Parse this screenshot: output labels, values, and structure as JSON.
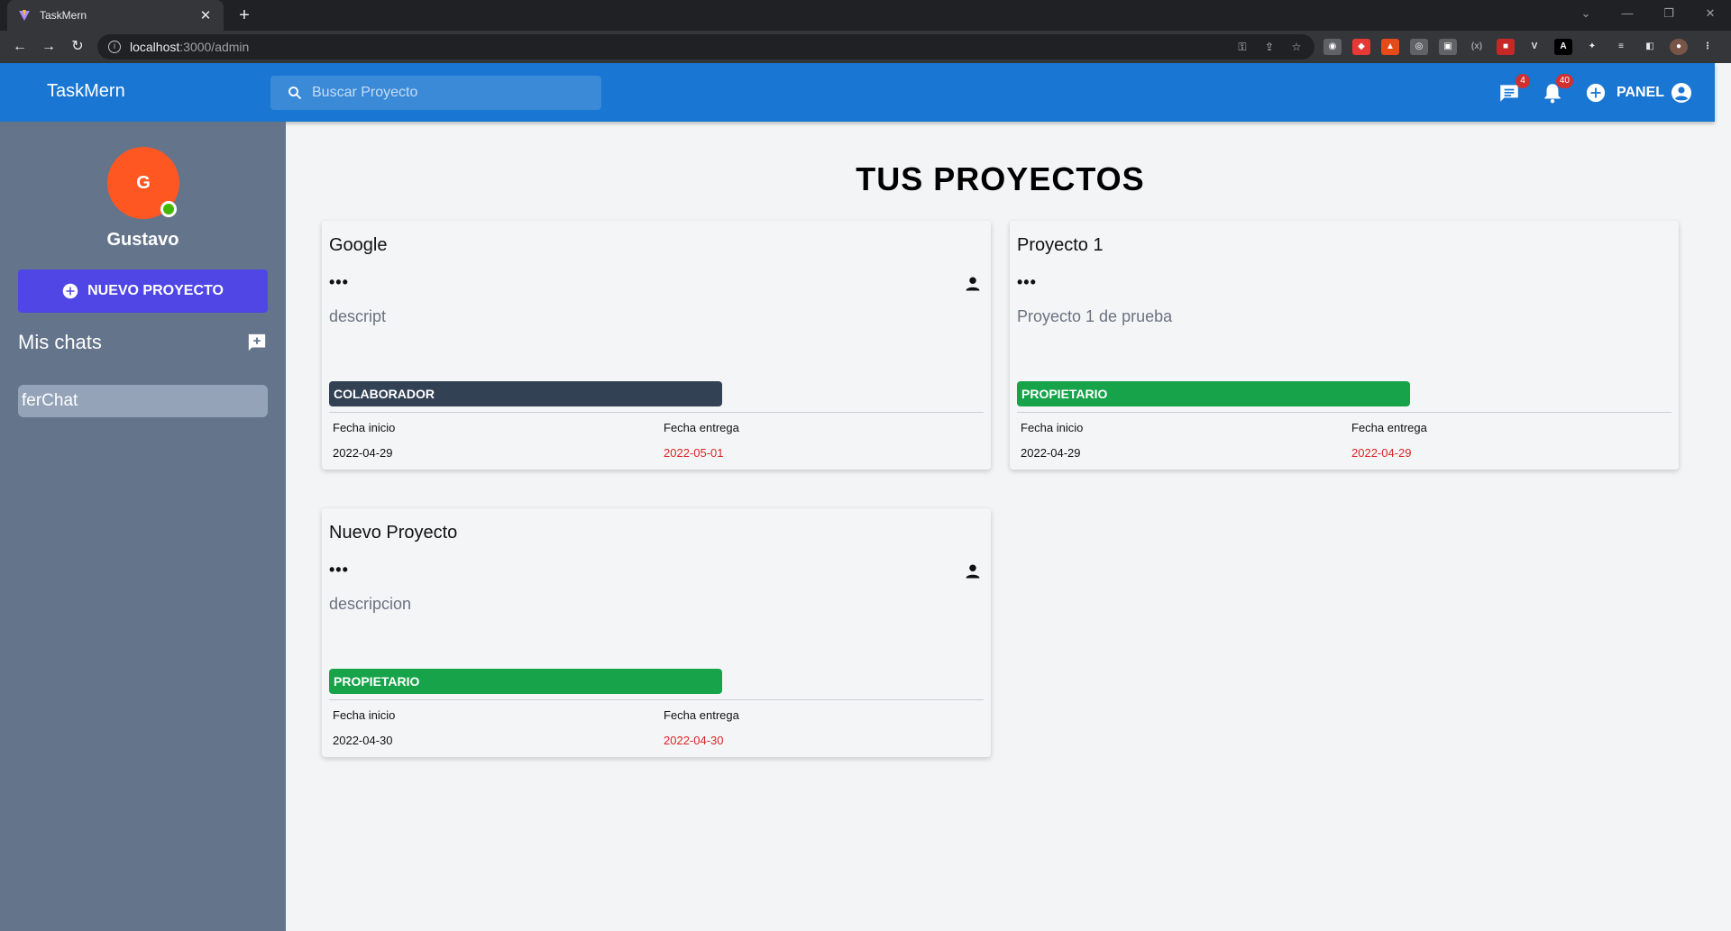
{
  "browser": {
    "tab_title": "TaskMern",
    "url_host": "localhost",
    "url_path": ":3000/admin"
  },
  "app": {
    "brand": "TaskMern",
    "search_placeholder": "Buscar Proyecto",
    "chat_badge": "4",
    "notif_badge": "40",
    "panel_label": "PANEL"
  },
  "sidebar": {
    "avatar_initial": "G",
    "username": "Gustavo",
    "new_project_label": "NUEVO PROYECTO",
    "chats_title": "Mis chats",
    "chats": [
      "ferChat"
    ]
  },
  "main": {
    "title": "TUS PROYECTOS",
    "label_start": "Fecha inicio",
    "label_due": "Fecha entrega",
    "dots": "•••",
    "projects": [
      {
        "name": "Google",
        "description": "descript",
        "role": "COLABORADOR",
        "role_color": "#334155",
        "start": "2022-04-29",
        "due": "2022-05-01",
        "show_person": true
      },
      {
        "name": "Proyecto 1",
        "description": "Proyecto 1 de prueba",
        "role": "PROPIETARIO",
        "role_color": "#16a34a",
        "start": "2022-04-29",
        "due": "2022-04-29",
        "show_person": false
      },
      {
        "name": "Nuevo Proyecto",
        "description": "descripcion",
        "role": "PROPIETARIO",
        "role_color": "#16a34a",
        "start": "2022-04-30",
        "due": "2022-04-30",
        "show_person": true
      }
    ]
  },
  "colors": {
    "appbar": "#1976d2",
    "sidebar": "#64748b",
    "due_date": "#dc2626"
  }
}
